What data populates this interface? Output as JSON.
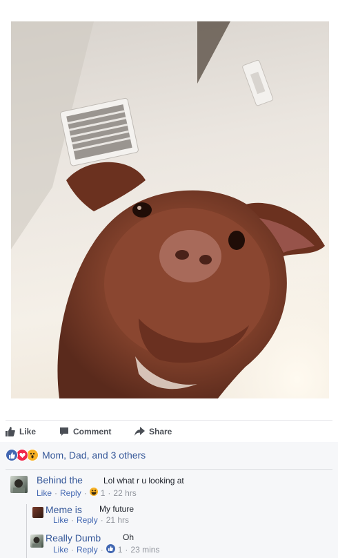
{
  "actions": {
    "like": "Like",
    "comment": "Comment",
    "share": "Share"
  },
  "reactions": {
    "summary": "Mom, Dad, and 3 others",
    "icons": [
      "like-reaction",
      "love-reaction",
      "wow-reaction"
    ]
  },
  "comments": [
    {
      "author": "Behind the",
      "text": "Lol what r u looking at",
      "like": "Like",
      "reply": "Reply",
      "reaction_count": "1",
      "time": "22 hrs",
      "reaction_icon": "haha-reaction"
    },
    {
      "author": "Meme is",
      "text": "My future",
      "like": "Like",
      "reply": "Reply",
      "time": "21 hrs"
    },
    {
      "author": "Really Dumb",
      "text": "Oh",
      "like": "Like",
      "reply": "Reply",
      "reaction_count": "1",
      "time": "23 mins",
      "reaction_icon": "like-reaction"
    }
  ],
  "colors": {
    "link": "#365899",
    "meta": "#90949c",
    "like_blue": "#4267b2",
    "love_red": "#f0284a",
    "wow_yellow": "#f7b125"
  }
}
